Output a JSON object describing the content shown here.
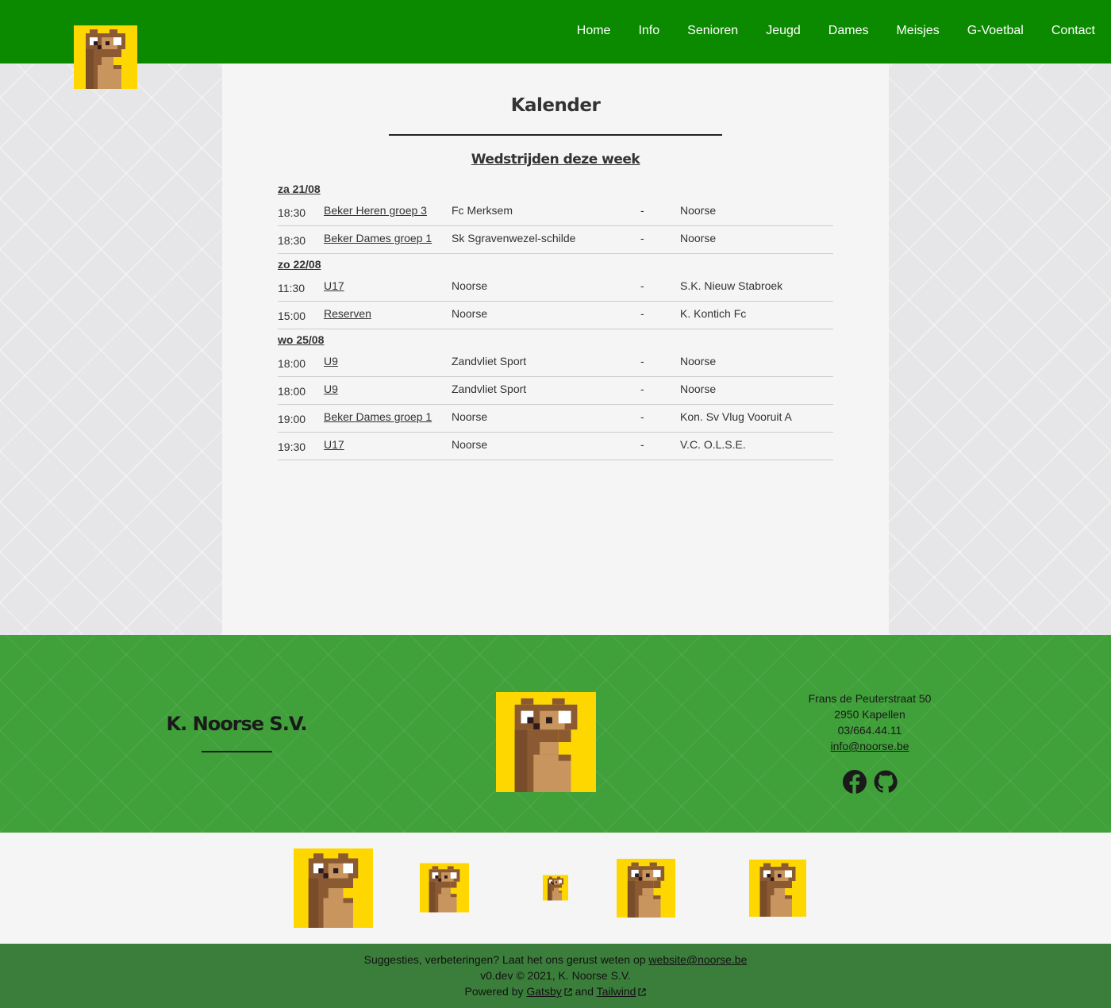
{
  "colors": {
    "header": "#0b8a00",
    "footer": "#40a03a",
    "bottom": "#3b7e3b",
    "logo_bg": "#ffd700",
    "bear_dark": "#8b5a32",
    "bear_light": "#c8955e"
  },
  "nav": {
    "items": [
      {
        "label": "Home",
        "key": "home"
      },
      {
        "label": "Info",
        "key": "info"
      },
      {
        "label": "Senioren",
        "key": "senioren"
      },
      {
        "label": "Jeugd",
        "key": "jeugd"
      },
      {
        "label": "Dames",
        "key": "dames"
      },
      {
        "label": "Meisjes",
        "key": "meisjes"
      },
      {
        "label": "G-Voetbal",
        "key": "g-voetbal"
      },
      {
        "label": "Contact",
        "key": "contact"
      }
    ]
  },
  "main": {
    "title": "Kalender",
    "subtitle": "Wedstrijden deze week",
    "days": [
      {
        "label": "za 21/08",
        "matches": [
          {
            "time": "18:30",
            "team": "Beker Heren groep 3",
            "home": "Fc Merksem",
            "sep": "-",
            "away": "Noorse"
          },
          {
            "time": "18:30",
            "team": "Beker Dames groep 1",
            "home": "Sk Sgravenwezel-schilde",
            "sep": "-",
            "away": "Noorse"
          }
        ]
      },
      {
        "label": "zo 22/08",
        "matches": [
          {
            "time": "11:30",
            "team": "U17",
            "home": "Noorse",
            "sep": "-",
            "away": "S.K. Nieuw Stabroek"
          },
          {
            "time": "15:00",
            "team": "Reserven",
            "home": "Noorse",
            "sep": "-",
            "away": "K. Kontich Fc"
          }
        ]
      },
      {
        "label": "wo 25/08",
        "matches": [
          {
            "time": "18:00",
            "team": "U9",
            "home": "Zandvliet Sport",
            "sep": "-",
            "away": "Noorse"
          },
          {
            "time": "18:00",
            "team": "U9",
            "home": "Zandvliet Sport",
            "sep": "-",
            "away": "Noorse"
          },
          {
            "time": "19:00",
            "team": "Beker Dames groep 1",
            "home": "Noorse",
            "sep": "-",
            "away": "Kon. Sv Vlug Vooruit A"
          },
          {
            "time": "19:30",
            "team": "U17",
            "home": "Noorse",
            "sep": "-",
            "away": "V.C. O.L.S.E."
          }
        ]
      }
    ]
  },
  "footer": {
    "club_name": "K. Noorse S.V.",
    "address_line1": "Frans de Peuterstraat 50",
    "address_line2": "2950 Kapellen",
    "phone": "03/664.44.11",
    "email": "info@noorse.be",
    "socials": [
      {
        "icon": "facebook-icon"
      },
      {
        "icon": "github-icon"
      }
    ]
  },
  "sponsors": [
    {
      "name": "sponsor-1"
    },
    {
      "name": "sponsor-2"
    },
    {
      "name": "sponsor-3"
    },
    {
      "name": "sponsor-4"
    },
    {
      "name": "sponsor-5"
    }
  ],
  "bottom": {
    "suggest_text": "Suggesties, verbeteringen? Laat het ons gerust weten op",
    "suggest_email": "website@noorse.be",
    "version_line": "v0.dev © 2021, K. Noorse S.V.",
    "powered_text": "Powered by",
    "gatsby": "Gatsby",
    "and_text": "and",
    "tailwind": "Tailwind"
  }
}
